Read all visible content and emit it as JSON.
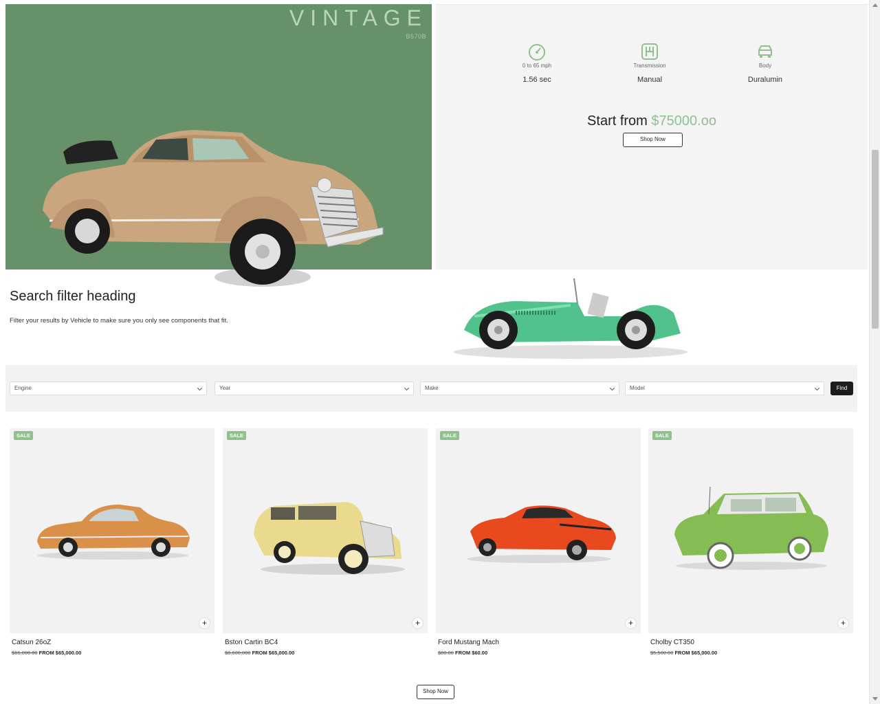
{
  "hero": {
    "title": "VINTAGE",
    "code": "B570B",
    "colors": {
      "panel": "#679169",
      "accent": "#8fc08d"
    }
  },
  "specs": [
    {
      "icon": "speedometer-icon",
      "label": "0 to 65 mph",
      "value": "1.56 sec"
    },
    {
      "icon": "gearshift-icon",
      "label": "Transmission",
      "value": "Manual"
    },
    {
      "icon": "car-body-icon",
      "label": "Body",
      "value": "Duralumin"
    }
  ],
  "pricing": {
    "prefix": "Start from",
    "amount": "$75000.oo",
    "shop_label": "Shop Now"
  },
  "filter": {
    "heading": "Search filter heading",
    "description": "Filter your results by Vehicle to make sure you only see components that fit.",
    "selects": [
      "Engine",
      "Year",
      "Make",
      "Model"
    ],
    "find_label": "Find"
  },
  "products": [
    {
      "badge": "SALE",
      "name": "Catsun 26oZ",
      "old_price": "$66,000.00",
      "price": "FROM $65,000.00",
      "color": "#d9914a"
    },
    {
      "badge": "SALE",
      "name": "Bston Cartin BC4",
      "old_price": "$8,600,000",
      "price": "FROM $65,000.00",
      "color": "#e9da8e"
    },
    {
      "badge": "SALE",
      "name": "Ford Mustang Mach",
      "old_price": "$80.00",
      "price": "FROM $60.00",
      "color": "#e8491f"
    },
    {
      "badge": "SALE",
      "name": "Cholby CT350",
      "old_price": "$5,500.00",
      "price": "FROM $65,000.00",
      "color": "#86bd52"
    }
  ],
  "footer": {
    "shop_label": "Shop Now"
  }
}
